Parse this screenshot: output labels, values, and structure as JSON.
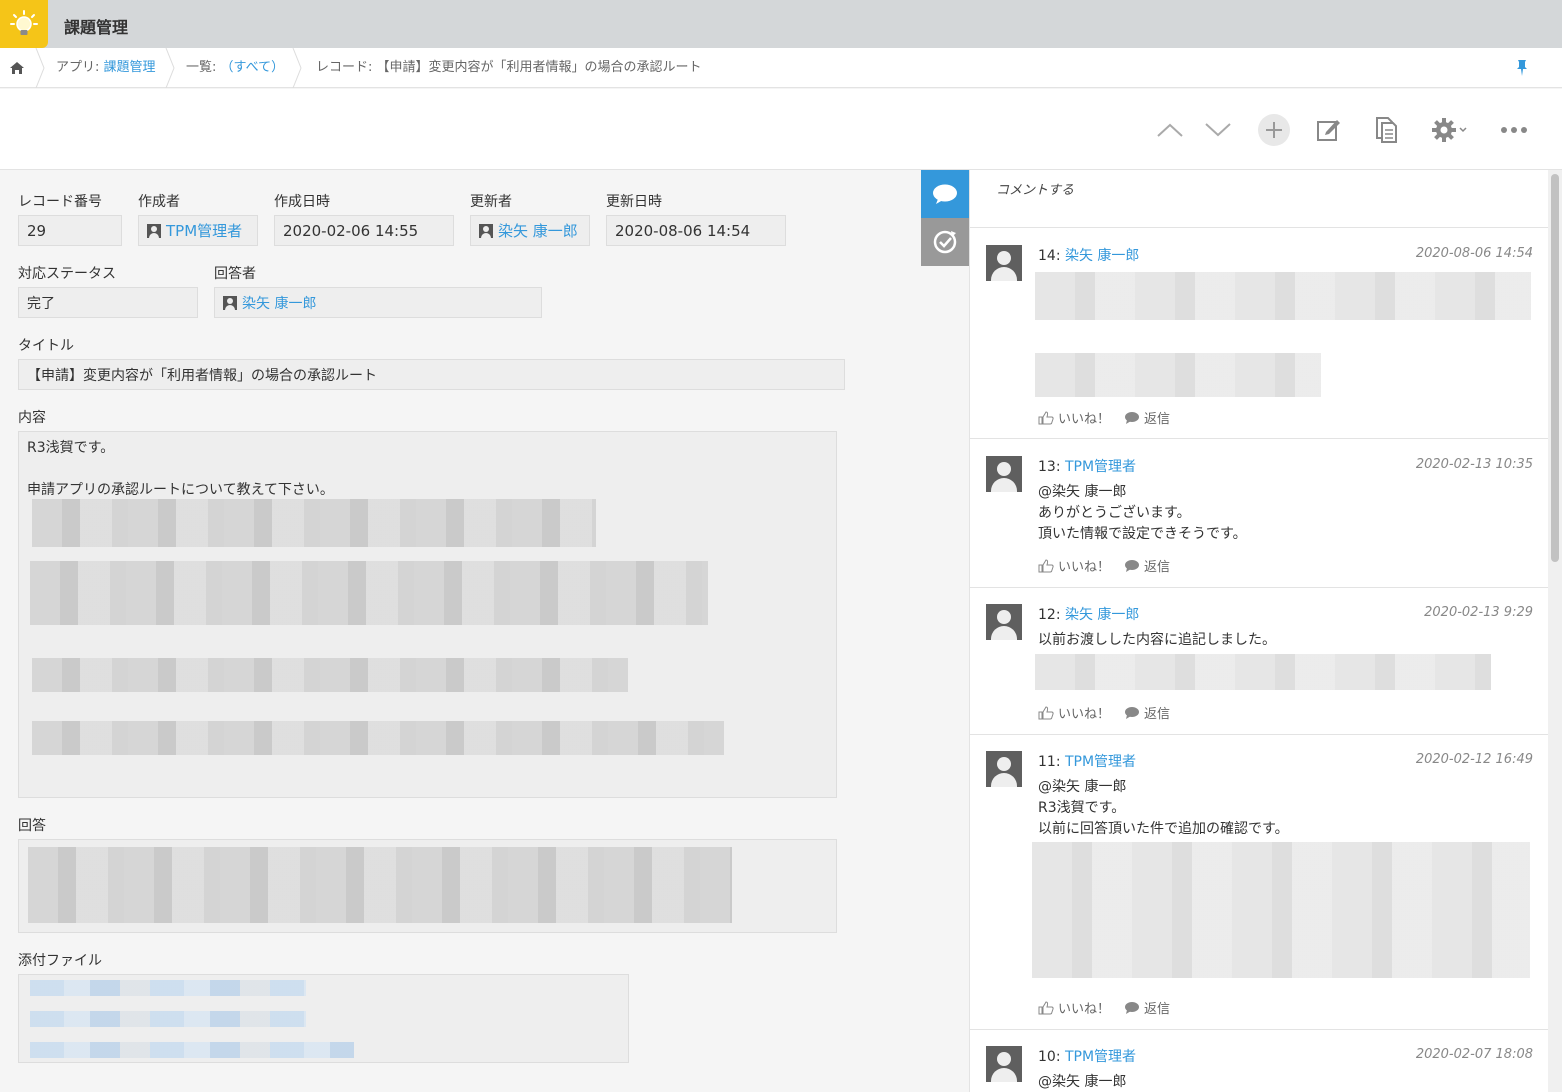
{
  "app": {
    "title": "課題管理"
  },
  "breadcrumb": {
    "app_prefix": "アプリ:",
    "app_name": "課題管理",
    "list_prefix": "一覧:",
    "list_name": "（すべて）",
    "record_prefix": "レコード:",
    "record_name": "【申請】変更内容が「利用者情報」の場合の承認ルート"
  },
  "record": {
    "record_no_label": "レコード番号",
    "record_no": "29",
    "creator_label": "作成者",
    "creator": "TPM管理者",
    "created_label": "作成日時",
    "created": "2020-02-06 14:55",
    "updater_label": "更新者",
    "updater": "染矢 康一郎",
    "updated_label": "更新日時",
    "updated": "2020-08-06 14:54",
    "status_label": "対応ステータス",
    "status": "完了",
    "assignee_label": "回答者",
    "assignee": "染矢 康一郎",
    "title_label": "タイトル",
    "title": "【申請】変更内容が「利用者情報」の場合の承認ルート",
    "content_label": "内容",
    "content_line1": "R3浅賀です。",
    "content_line2": "申請アプリの承認ルートについて教えて下さい。",
    "answer_label": "回答",
    "attachment_label": "添付ファイル"
  },
  "comments": {
    "placeholder": "コメントする",
    "like_label": "いいね！",
    "reply_label": "返信",
    "items": [
      {
        "num": "14:",
        "author": "染矢 康一郎",
        "date": "2020-08-06 14:54"
      },
      {
        "num": "13:",
        "author": "TPM管理者",
        "date": "2020-02-13 10:35",
        "mention": "@染矢 康一郎",
        "line1": "ありがとうございます。",
        "line2": "頂いた情報で設定できそうです。"
      },
      {
        "num": "12:",
        "author": "染矢 康一郎",
        "date": "2020-02-13 9:29",
        "line1": "以前お渡しした内容に追記しました。"
      },
      {
        "num": "11:",
        "author": "TPM管理者",
        "date": "2020-02-12 16:49",
        "mention": "@染矢 康一郎",
        "line1": "R3浅賀です。",
        "line2": "以前に回答頂いた件で追加の確認です。"
      },
      {
        "num": "10:",
        "author": "TPM管理者",
        "date": "2020-02-07 18:08",
        "mention": "@染矢 康一郎"
      }
    ]
  },
  "colors": {
    "accent": "#3498db",
    "app_icon": "#f5c518",
    "active_tab": "#3498db"
  }
}
